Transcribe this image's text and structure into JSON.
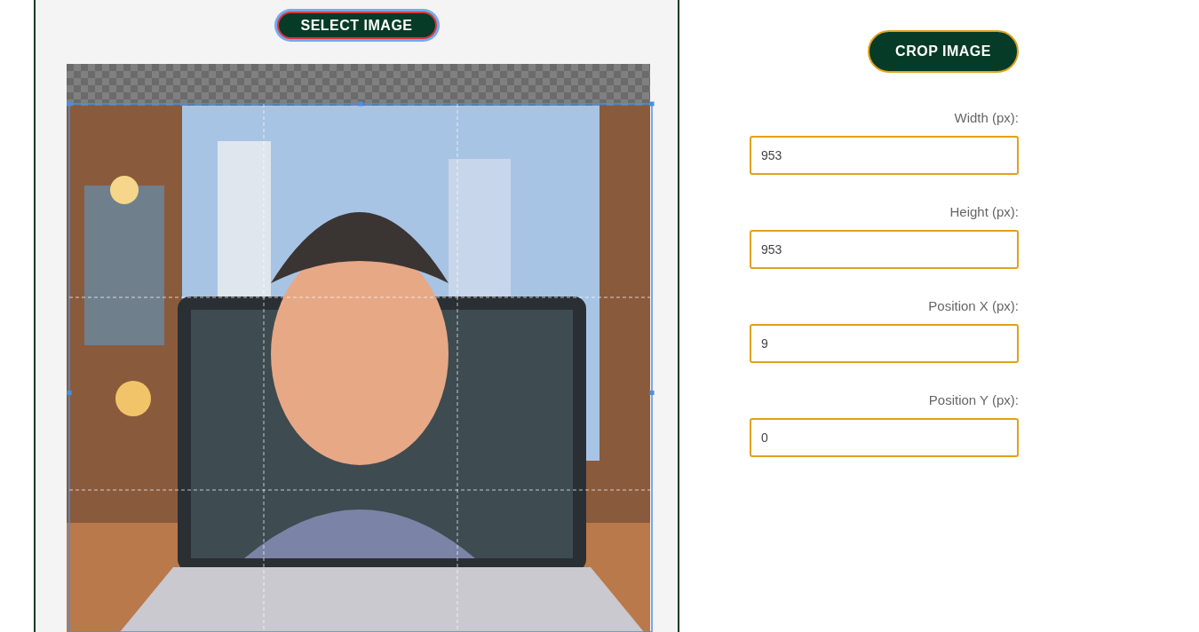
{
  "select_button": {
    "label": "SELECT IMAGE",
    "focused": true
  },
  "crop_button": {
    "label": "CROP IMAGE"
  },
  "fields": [
    {
      "label": "Width (px):",
      "value": "953"
    },
    {
      "label": "Height (px):",
      "value": "953"
    },
    {
      "label": "Position X (px):",
      "value": "9"
    },
    {
      "label": "Position Y (px):",
      "value": "0"
    }
  ]
}
